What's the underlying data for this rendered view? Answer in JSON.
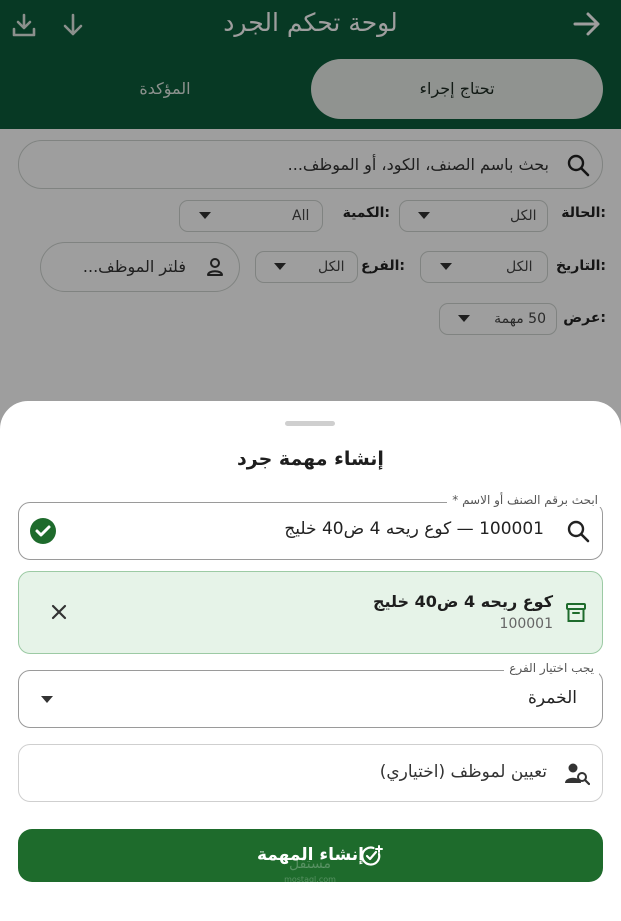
{
  "header": {
    "title": "لوحة تحكم الجرد",
    "tabs": [
      {
        "label": "تحتاج إجراء",
        "active": true
      },
      {
        "label": "المؤكدة",
        "active": false
      }
    ]
  },
  "filters": {
    "search_placeholder": "بحث باسم الصنف، الكود، أو الموظف...",
    "status": {
      "label": "الحالة:",
      "value": "الكل"
    },
    "quantity": {
      "label": "الكمية:",
      "value": "All"
    },
    "date": {
      "label": "التاريخ:",
      "value": "الكل"
    },
    "branch": {
      "label": "الفرع:",
      "value": "الكل"
    },
    "employee_filter": "فلتر الموظف...",
    "view": {
      "label": "عرض:",
      "value": "50 مهمة"
    }
  },
  "sheet": {
    "title": "إنشاء مهمة جرد",
    "item_search": {
      "label": "ابحث برقم الصنف أو الاسم *",
      "value": "100001 — كوع ريحه 4 ض40 خليج"
    },
    "selected_item": {
      "name": "كوع ريحه 4 ض40 خليج",
      "code": "100001"
    },
    "branch_select": {
      "label": "يجب اختيار الفرع",
      "value": "الخمرة"
    },
    "assign_placeholder": "تعيين لموظف (اختياري)",
    "submit_label": "إنشاء المهمة"
  },
  "watermark": {
    "line1": "مستقل",
    "line2": "mostaql.com"
  },
  "colors": {
    "header": "#0c5c3a",
    "submit": "#1e6b2c",
    "success": "#1e6b2c",
    "selected_bg": "#e6f3e8"
  }
}
